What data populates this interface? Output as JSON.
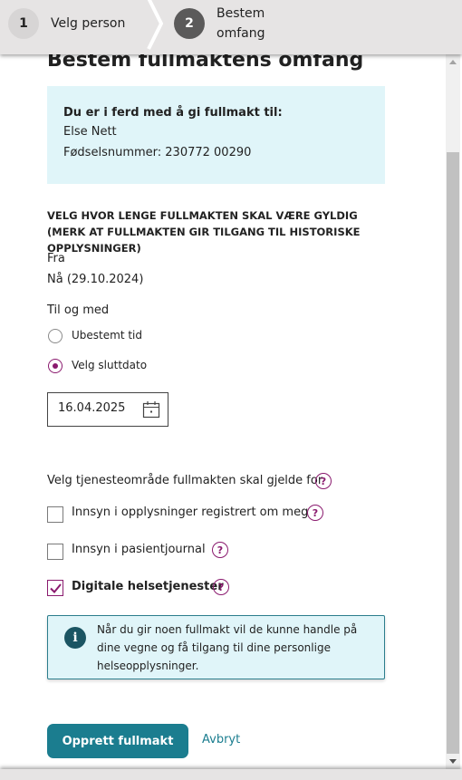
{
  "stepper": {
    "steps": [
      {
        "number": "1",
        "label": "Velg person",
        "active": false
      },
      {
        "number": "2",
        "label": "Bestem omfang",
        "active": true
      }
    ]
  },
  "page": {
    "title": "Bestem fullmaktens omfang"
  },
  "recipient": {
    "heading": "Du er i ferd med å gi fullmakt til:",
    "name": "Else Nett",
    "ssn_line": "Fødselsnummer: 230772 00290"
  },
  "validity": {
    "heading": "VELG HVOR LENGE FULLMAKTEN SKAL VÆRE GYLDIG (MERK AT FULLMAKTEN GIR TILGANG TIL HISTORISKE OPPLYSNINGER)",
    "from_label": "Fra",
    "from_value": "Nå (29.10.2024)",
    "to_label": "Til og med",
    "options": [
      {
        "label": "Ubestemt tid",
        "selected": false
      },
      {
        "label": "Velg sluttdato",
        "selected": true
      }
    ],
    "end_date": "16.04.2025"
  },
  "services": {
    "heading": "Velg tjenesteområde fullmakten skal gjelde for",
    "help_glyph": "?",
    "items": [
      {
        "label": "Innsyn i opplysninger registrert om meg",
        "checked": false
      },
      {
        "label": "Innsyn i pasientjournal",
        "checked": false
      },
      {
        "label": "Digitale helsetjenester",
        "checked": true
      }
    ]
  },
  "note": {
    "icon": "i",
    "text": "Når du gir noen fullmakt vil de kunne handle på dine vegne og få tilgang til dine personlige helseopplysninger."
  },
  "actions": {
    "primary_label": "Opprett fullmakt",
    "cancel_label": "Avbryt"
  },
  "colors": {
    "accent": "#8a1a6e",
    "primary": "#1b7d8f",
    "info_bg": "#e0f5f9"
  }
}
